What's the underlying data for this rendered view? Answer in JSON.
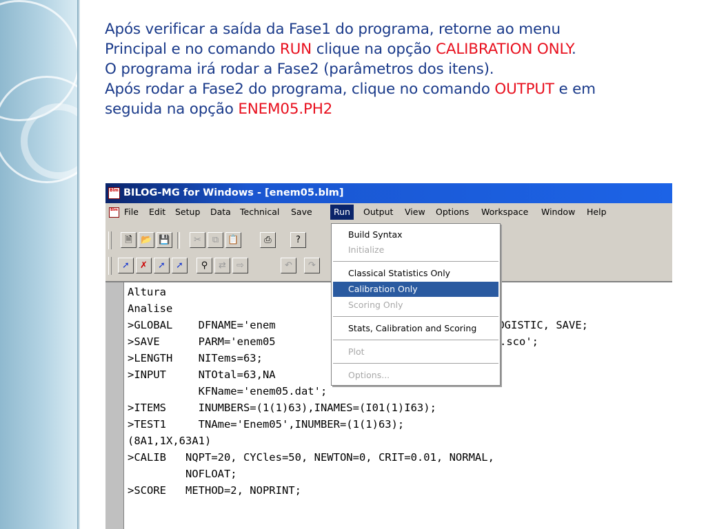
{
  "slide": {
    "line1": "Após verificar a saída da Fase1 do programa, retorne ao menu",
    "line2_a": "Principal e no comando ",
    "line2_b": "RUN",
    "line2_c": " clique na opção ",
    "line2_d": "CALIBRATION ONLY",
    "line2_e": ".",
    "line3": "O programa irá rodar a Fase2 (parâmetros dos itens).",
    "line4_a": "Após rodar a Fase2 do programa, clique no comando ",
    "line4_b": "OUTPUT",
    "line4_c": " e em",
    "line5_a": "seguida na opção ",
    "line5_b": "ENEM05.PH2",
    "text_color": "#1a3a8a",
    "highlight_color": "#e8101e"
  },
  "window": {
    "title": "BILOG-MG for Windows - [enem05.blm]",
    "icon_text": "Blm",
    "title_bar_color": "#0a246a"
  },
  "menubar": {
    "items": [
      "File",
      "Edit",
      "Setup",
      "Data",
      "Technical",
      "Save",
      "Run",
      "Output",
      "View",
      "Options",
      "Workspace",
      "Window",
      "Help"
    ],
    "active": "Run"
  },
  "toolbar1": {
    "icons": [
      "new-file-icon",
      "open-folder-icon",
      "save-disk-icon",
      "cut-icon",
      "copy-icon",
      "paste-icon",
      "print-icon",
      "help-icon"
    ]
  },
  "toolbar2": {
    "icons": [
      "run-arrow-icon",
      "stop-arrow-icon",
      "step-up-icon",
      "step-back-icon",
      "find-icon",
      "find-replace-icon",
      "find-next-icon",
      "undo-icon",
      "redo-icon"
    ]
  },
  "run_menu": {
    "items": [
      {
        "label": "Build Syntax",
        "enabled": true
      },
      {
        "label": "Initialize",
        "enabled": false
      },
      {
        "label": "Classical Statistics Only",
        "enabled": true
      },
      {
        "label": "Calibration Only",
        "enabled": true,
        "highlighted": true
      },
      {
        "label": "Scoring Only",
        "enabled": false
      },
      {
        "label": "Stats, Calibration and Scoring",
        "enabled": true
      },
      {
        "label": "Plot",
        "enabled": false
      },
      {
        "label": "Options...",
        "enabled": false
      }
    ]
  },
  "editor": {
    "lines": [
      "Altura",
      "Analise",
      ">GLOBAL    DFNAME='enem",
      ">SAVE      PARM='enem05",
      ">LENGTH    NITems=63;",
      ">INPUT     NTOtal=63,NA",
      "           KFName='enem05.dat';",
      ">ITEMS     INUMBERS=(1(1)63),INAMES=(I01(1)I63);",
      ">TEST1     TNAme='Enem05',INUMBER=(1(1)63);",
      "(8A1,1X,63A1)",
      ">CALIB   NQPT=20, CYCles=50, NEWTON=0, CRIT=0.01, NORMAL,",
      "         NOFLOAT;",
      ">SCORE   METHOD=2, NOPRINT;"
    ],
    "line2_tail": "LOGISTIC, SAVE;",
    "line3_tail": ".sco';"
  }
}
